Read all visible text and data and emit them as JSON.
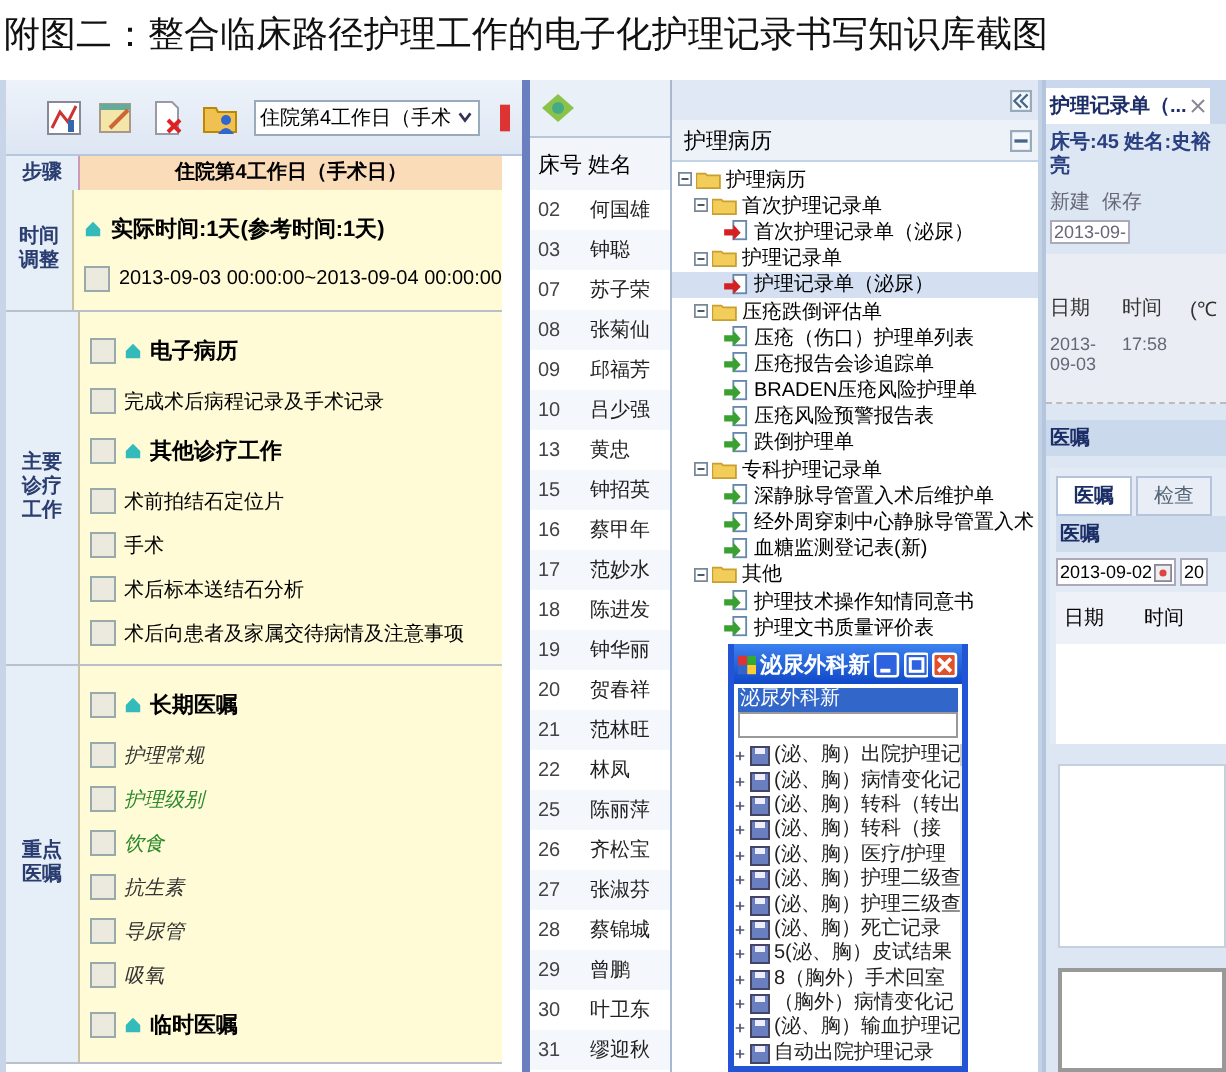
{
  "caption": "附图二：整合临床路径护理工作的电子化护理记录书写知识库截图",
  "pathway": {
    "toolbar": {
      "dropdown": "住院第4工作日（手术"
    },
    "columns": [
      "步骤",
      "住院第4工作日（手术日）"
    ],
    "sections": [
      {
        "step": "时间调整",
        "items": [
          {
            "kind": "heading",
            "text": "实际时间:1天(参考时间:1天)"
          },
          {
            "kind": "task",
            "text": "2013-09-03 00:00:00~2013-09-04 00:00:00",
            "checked": false
          }
        ]
      },
      {
        "step": "主要诊疗工作",
        "items": [
          {
            "kind": "heading",
            "text": "电子病历",
            "checked": false
          },
          {
            "kind": "task",
            "text": "完成术后病程记录及手术记录",
            "checked": false
          },
          {
            "kind": "heading",
            "text": "其他诊疗工作",
            "checked": false
          },
          {
            "kind": "task",
            "text": "术前拍结石定位片",
            "checked": false
          },
          {
            "kind": "task",
            "text": "手术",
            "checked": false
          },
          {
            "kind": "task",
            "text": "术后标本送结石分析",
            "checked": false
          },
          {
            "kind": "task",
            "text": "术后向患者及家属交待病情及注意事项",
            "checked": false
          }
        ]
      },
      {
        "step": "重点医嘱",
        "items": [
          {
            "kind": "heading",
            "text": "长期医嘱",
            "checked": false
          },
          {
            "kind": "order",
            "text": "护理常规",
            "checked": false,
            "color": "#333333"
          },
          {
            "kind": "order",
            "text": "护理级别",
            "checked": false,
            "color": "#2a8a2a"
          },
          {
            "kind": "order",
            "text": "饮食",
            "checked": false,
            "color": "#2a8a2a"
          },
          {
            "kind": "order",
            "text": "抗生素",
            "checked": false,
            "color": "#333333"
          },
          {
            "kind": "order",
            "text": "导尿管",
            "checked": false,
            "color": "#333333"
          },
          {
            "kind": "order",
            "text": "吸氧",
            "checked": false,
            "color": "#333333"
          },
          {
            "kind": "heading",
            "text": "临时医嘱",
            "checked": false
          }
        ]
      }
    ]
  },
  "patients": {
    "columns": [
      "床号",
      "姓名"
    ],
    "rows": [
      [
        "02",
        "何国雄"
      ],
      [
        "03",
        "钟聪"
      ],
      [
        "07",
        "苏子荣"
      ],
      [
        "08",
        "张菊仙"
      ],
      [
        "09",
        "邱福芳"
      ],
      [
        "10",
        "吕少强"
      ],
      [
        "13",
        "黄忠"
      ],
      [
        "15",
        "钟招英"
      ],
      [
        "16",
        "蔡甲年"
      ],
      [
        "17",
        "范妙水"
      ],
      [
        "18",
        "陈进发"
      ],
      [
        "19",
        "钟华丽"
      ],
      [
        "20",
        "贺春祥"
      ],
      [
        "21",
        "范林旺"
      ],
      [
        "22",
        "林凤"
      ],
      [
        "25",
        "陈丽萍"
      ],
      [
        "26",
        "齐松宝"
      ],
      [
        "27",
        "张淑芬"
      ],
      [
        "28",
        "蔡锦城"
      ],
      [
        "29",
        "曾鹏"
      ],
      [
        "30",
        "叶卫东"
      ],
      [
        "31",
        "缪迎秋"
      ]
    ]
  },
  "records_tree": {
    "title": "护理病历",
    "items": [
      {
        "kind": "folder",
        "text": "护理病历",
        "expanded": true,
        "children": [
          {
            "kind": "folder",
            "text": "首次护理记录单",
            "expanded": true,
            "children": [
              {
                "kind": "doc",
                "text": "首次护理记录单（泌尿）",
                "color": "#d42020",
                "selected": false
              }
            ]
          },
          {
            "kind": "folder",
            "text": "护理记录单",
            "expanded": true,
            "children": [
              {
                "kind": "doc",
                "text": "护理记录单（泌尿）",
                "color": "#d42020",
                "selected": true
              }
            ]
          },
          {
            "kind": "folder",
            "text": "压疮跌倒评估单",
            "expanded": true,
            "children": [
              {
                "kind": "doc",
                "text": "压疮（伤口）护理单列表",
                "color": "#3aa030",
                "selected": false
              },
              {
                "kind": "doc",
                "text": "压疮报告会诊追踪单",
                "color": "#3aa030",
                "selected": false
              },
              {
                "kind": "doc",
                "text": "BRADEN压疮风险护理单",
                "color": "#3aa030",
                "selected": false
              },
              {
                "kind": "doc",
                "text": "压疮风险预警报告表",
                "color": "#3aa030",
                "selected": false
              },
              {
                "kind": "doc",
                "text": "跌倒护理单",
                "color": "#3aa030",
                "selected": false
              }
            ]
          },
          {
            "kind": "folder",
            "text": "专科护理记录单",
            "expanded": true,
            "children": [
              {
                "kind": "doc",
                "text": "深静脉导管置入术后维护单",
                "color": "#3aa030",
                "selected": false
              },
              {
                "kind": "doc",
                "text": "经外周穿刺中心静脉导管置入术",
                "color": "#3aa030",
                "selected": false
              },
              {
                "kind": "doc",
                "text": "血糖监测登记表(新)",
                "color": "#3aa030",
                "selected": false
              }
            ]
          },
          {
            "kind": "folder",
            "text": "其他",
            "expanded": true,
            "children": [
              {
                "kind": "doc",
                "text": "护理技术操作知情同意书",
                "color": "#3aa030",
                "selected": false
              },
              {
                "kind": "doc",
                "text": "护理文书质量评价表",
                "color": "#3aa030",
                "selected": false
              }
            ]
          }
        ]
      }
    ]
  },
  "template_window": {
    "title": "泌尿外科新",
    "selected_value": "泌尿外科新",
    "items": [
      "(泌、胸）出院护理记",
      "(泌、胸）病情变化记",
      "(泌、胸）转科（转出",
      "(泌、胸）转科（接",
      "(泌、胸）医疗/护理",
      "(泌、胸）护理二级查",
      "(泌、胸）护理三级查",
      "(泌、胸）死亡记录",
      "5(泌、胸）皮试结果",
      "8（胸外）手术回室",
      "（胸外）病情变化记",
      "(泌、胸）输血护理记",
      "自动出院护理记录"
    ]
  },
  "record_panel": {
    "tab": "护理记录单（...",
    "patient": "床号:45 姓名:史裕亮",
    "actions": [
      "新建",
      "保存"
    ],
    "date_field": "2013-09-",
    "columns": [
      "日期",
      "时间",
      "(℃"
    ],
    "rows": [
      [
        "2013-09-03",
        "17:58"
      ]
    ],
    "orders": {
      "title": "医嘱",
      "tabs": [
        {
          "label": "医嘱",
          "selected": true
        },
        {
          "label": "检查",
          "selected": false
        }
      ],
      "subtitle": "医嘱",
      "date_from": "2013-09-02",
      "date_to": "20",
      "columns": [
        "日期",
        "时间"
      ]
    }
  }
}
